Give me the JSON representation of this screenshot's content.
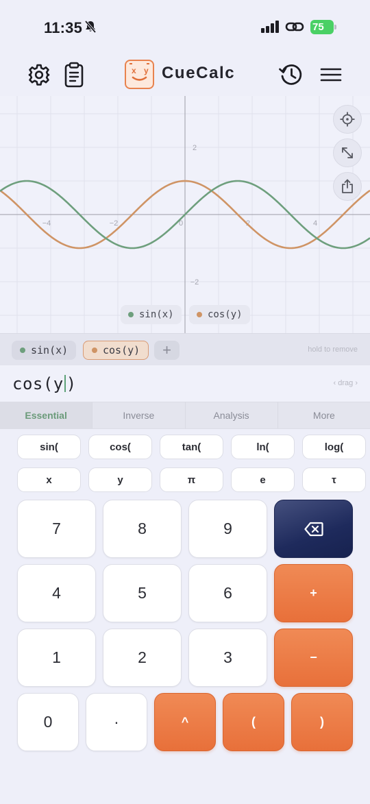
{
  "status": {
    "time": "11:35",
    "battery": "75"
  },
  "header": {
    "title": "CueCalc",
    "logo_x": "x",
    "logo_y": "y"
  },
  "graph": {
    "y_ticks": [
      "2",
      "−2"
    ],
    "x_ticks": [
      "−4",
      "−2",
      "0",
      "2",
      "4"
    ],
    "legend": [
      {
        "label": "sin(x)",
        "color": "#6e9f7d"
      },
      {
        "label": "cos(y)",
        "color": "#cf9465"
      }
    ],
    "buttons": [
      "crosshair-icon",
      "expand-icon",
      "share-icon"
    ]
  },
  "functions": {
    "chips": [
      {
        "label": "sin(x)",
        "color": "#6e9f7d"
      },
      {
        "label": "cos(y)",
        "color": "#cf9465"
      }
    ],
    "add_label": "+",
    "hint": "hold to remove"
  },
  "expression": {
    "before": "cos(y",
    "after": ")",
    "drag_hint": "‹ drag ›"
  },
  "tabs": [
    "Essential",
    "Inverse",
    "Analysis",
    "More"
  ],
  "function_keys": [
    [
      "sin(",
      "cos(",
      "tan(",
      "ln(",
      "log("
    ],
    [
      "x",
      "y",
      "π",
      "e",
      "τ"
    ]
  ],
  "keys": {
    "row1": [
      "7",
      "8",
      "9"
    ],
    "row2": [
      "4",
      "5",
      "6"
    ],
    "row3": [
      "1",
      "2",
      "3"
    ],
    "plus": "+",
    "minus": "−",
    "zero": "0",
    "dot": "·",
    "caret": "^",
    "lparen": "(",
    "rparen": ")"
  }
}
